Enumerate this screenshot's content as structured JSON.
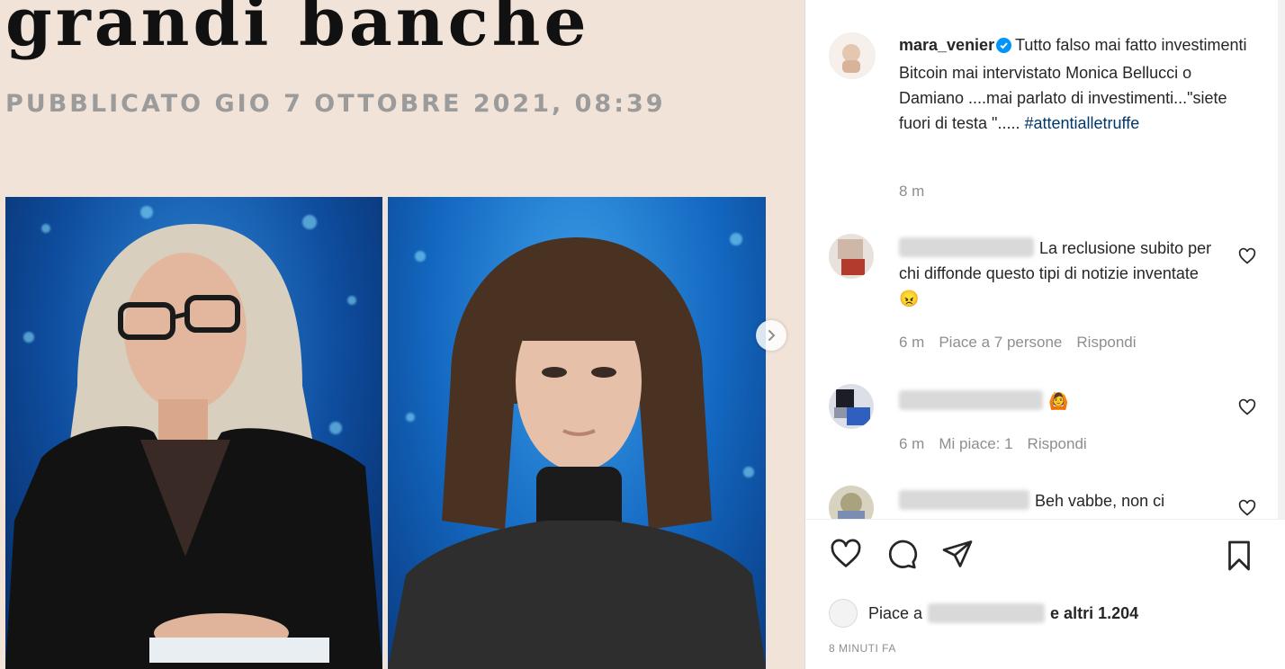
{
  "article": {
    "title": "grandi banche",
    "date": "PUBBLICATO GIO 7 OTTOBRE 2021, 08:39"
  },
  "post": {
    "author": "mara_venier",
    "caption": "Tutto falso mai fatto investimenti Bitcoin mai intervistato Monica Bellucci o Damiano ....mai parlato di investimenti...\"siete fuori di testa \"..... ",
    "hashtag": "#attentialletruffe",
    "caption_time": "8 m"
  },
  "comments": [
    {
      "text": "La reclusione subito per chi diffonde questo tipi di notizie inventate 😠",
      "time": "6 m",
      "likes": "Piace a 7 persone",
      "reply": "Rispondi"
    },
    {
      "text": "🙆",
      "time": "6 m",
      "likes": "Mi piace: 1",
      "reply": "Rispondi"
    },
    {
      "text": "Beh vabbe, non ci"
    }
  ],
  "likes": {
    "prefix": "Piace a",
    "suffix": "e altri 1.204"
  },
  "post_time": "8 MINUTI FA",
  "colors": {
    "accent": "#0095f6",
    "hashtag": "#00376b",
    "muted": "#8e8e8e",
    "media_bg": "#f1e3d8"
  },
  "icons": [
    "verified-icon",
    "heart-icon",
    "comment-icon",
    "share-icon",
    "bookmark-icon",
    "chevron-right-icon"
  ]
}
